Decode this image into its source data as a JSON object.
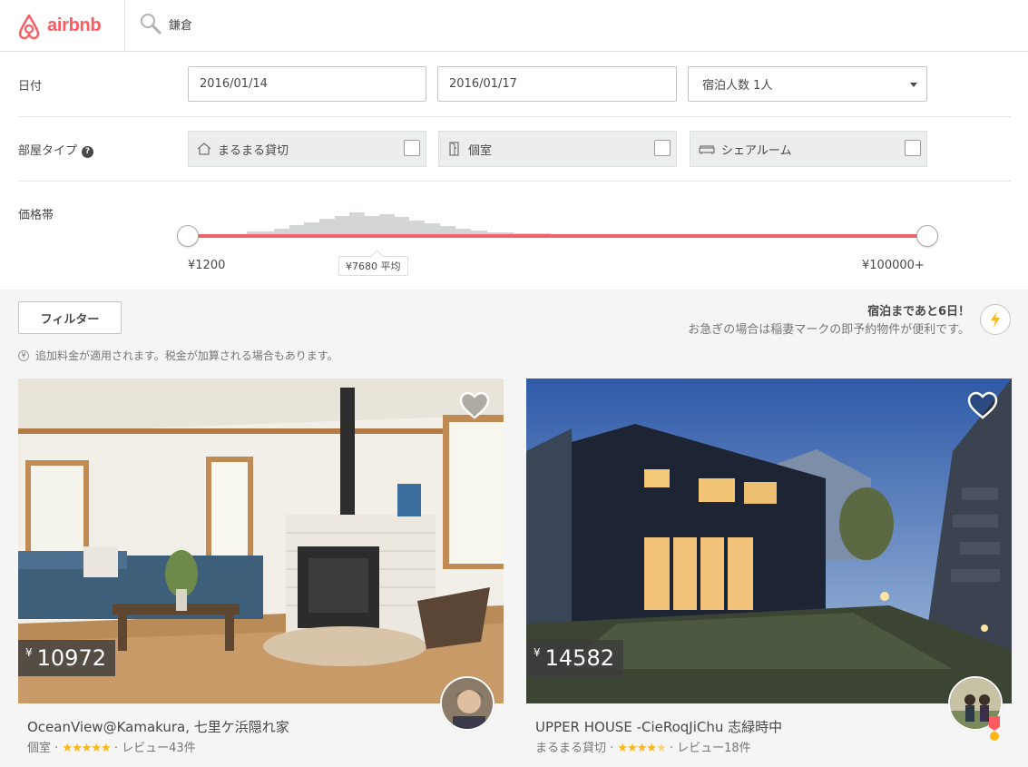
{
  "header": {
    "logo_text": "airbnb",
    "search_value": "鎌倉"
  },
  "filters": {
    "date_label": "日付",
    "checkin": "2016/01/14",
    "checkout": "2016/01/17",
    "guests": "宿泊人数 1人",
    "room_type_label": "部屋タイプ",
    "room_types": [
      {
        "label": "まるまる貸切",
        "icon": "home-icon"
      },
      {
        "label": "個室",
        "icon": "door-icon"
      },
      {
        "label": "シェアルーム",
        "icon": "couch-icon"
      }
    ],
    "price_label": "価格帯",
    "price_min": "¥1200",
    "price_max": "¥100000+",
    "price_avg": "¥7680 平均"
  },
  "results": {
    "filter_button": "フィルター",
    "promo_title": "宿泊まであと6日！",
    "promo_sub": "お急ぎの場合は稲妻マークの即予約物件が便利です。",
    "fee_note": "追加料金が適用されます。税金が加算される場合もあります。",
    "listings": [
      {
        "currency": "¥",
        "price": "10972",
        "title": "OceanView@Kamakura, 七里ケ浜隠れ家",
        "room_type": "個室",
        "rating": 5,
        "reviews": "レビュー43件"
      },
      {
        "currency": "¥",
        "price": "14582",
        "title": "UPPER HOUSE -CieRoqJiChu 志緑時中",
        "room_type": "まるまる貸切",
        "rating": 4.5,
        "reviews": "レビュー18件"
      }
    ]
  },
  "colors": {
    "brand": "#ff5a5f",
    "slider_track": "#f0636a",
    "star": "#fcb515"
  }
}
